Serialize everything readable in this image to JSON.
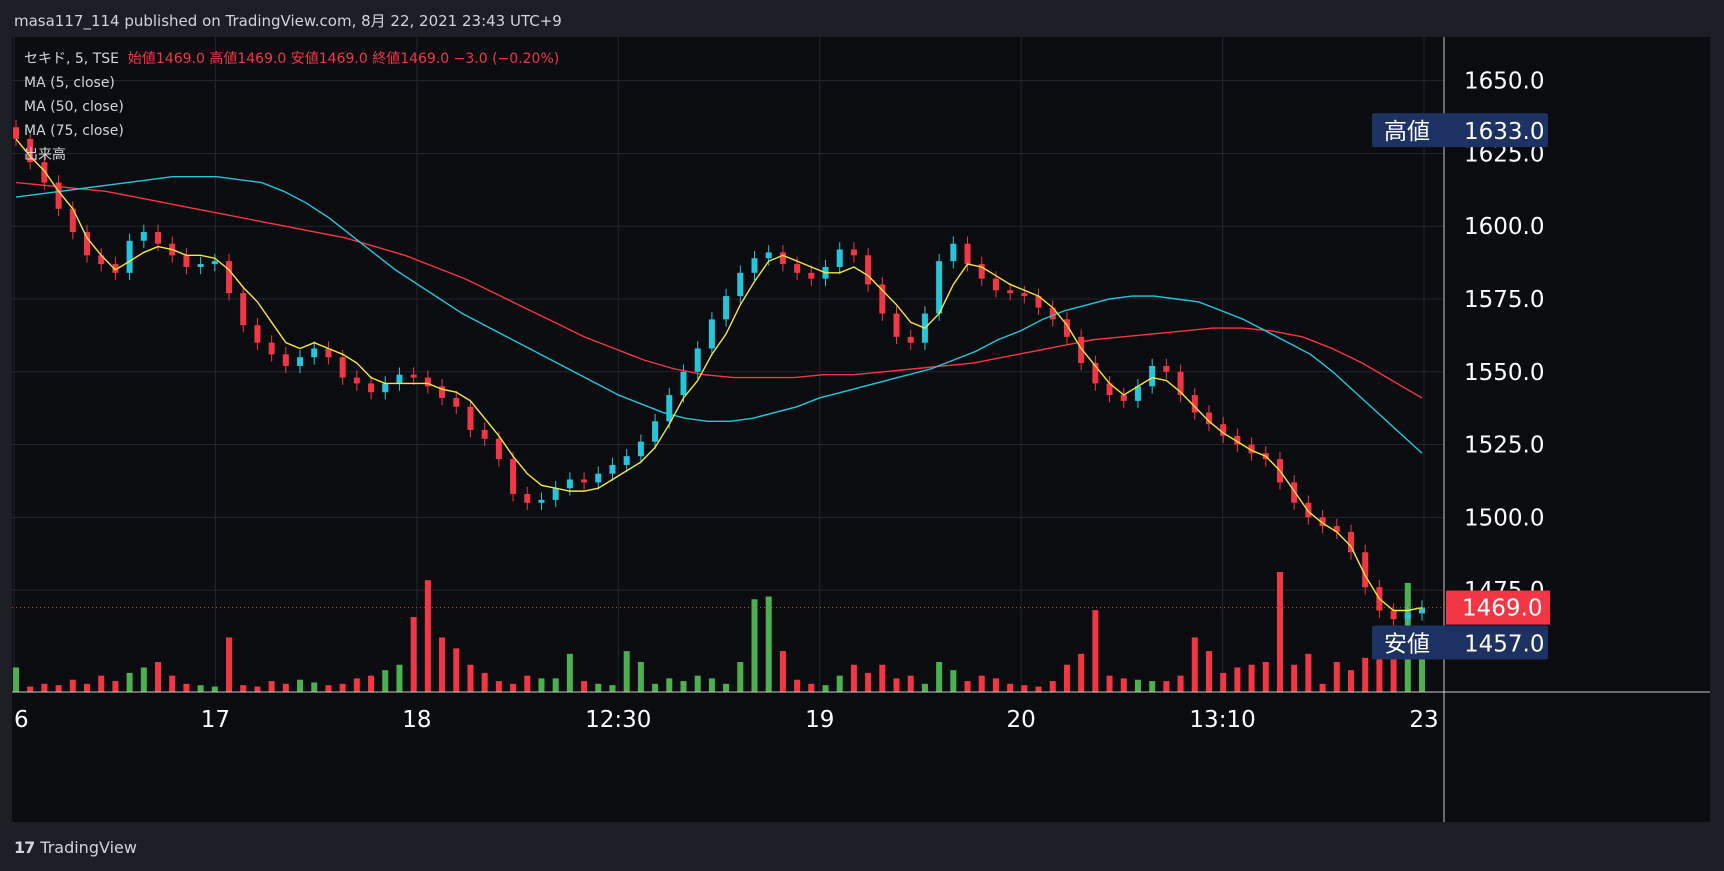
{
  "header": {
    "published_text": "masa117_114 published on TradingView.com, 8月 22, 2021 23:43 UTC+9"
  },
  "legend": {
    "symbol": "セキド, 5, TSE",
    "ohlc": "始値1469.0 高値1469.0 安値1469.0 終値1469.0 −3.0 (−0.20%)",
    "ma5": "MA (5, close)",
    "ma50": "MA (50, close)",
    "ma75": "MA (75, close)",
    "volume": "出来高"
  },
  "footer": {
    "brand": "TradingView",
    "logo_glyph": "17"
  },
  "colors": {
    "bg": "#0b0c10",
    "up": "#26c6da",
    "down": "#f23645",
    "ma5": "#f5e642",
    "ma50": "#26c6da",
    "ma75": "#f23645",
    "vol_up": "#4caf50",
    "vol_down": "#f23645",
    "label_bg": "#1e3163"
  },
  "chart_data": {
    "type": "candlestick",
    "x_ticks": [
      "6",
      "17",
      "18",
      "12:30",
      "19",
      "20",
      "13:10",
      "23"
    ],
    "y_ticks": [
      "1650.0",
      "1625.0",
      "1600.0",
      "1575.0",
      "1550.0",
      "1525.0",
      "1500.0",
      "1475.0"
    ],
    "ylim": [
      1440,
      1665
    ],
    "markers": [
      {
        "label": "高値",
        "value": "1633.0"
      },
      {
        "label": "安値",
        "value": "1457.0"
      }
    ],
    "last_price": "1469.0",
    "closes": [
      1630,
      1622,
      1615,
      1606,
      1598,
      1590,
      1587,
      1584,
      1595,
      1598,
      1594,
      1590,
      1586,
      1587,
      1588,
      1577,
      1566,
      1560,
      1556,
      1552,
      1555,
      1558,
      1555,
      1548,
      1546,
      1543,
      1546,
      1549,
      1548,
      1545,
      1541,
      1538,
      1530,
      1527,
      1520,
      1508,
      1505,
      1506,
      1510,
      1513,
      1512,
      1515,
      1518,
      1521,
      1526,
      1533,
      1542,
      1550,
      1558,
      1568,
      1576,
      1584,
      1589,
      1591,
      1587,
      1584,
      1582,
      1586,
      1592,
      1590,
      1580,
      1570,
      1562,
      1560,
      1570,
      1588,
      1594,
      1587,
      1582,
      1578,
      1577,
      1576,
      1572,
      1568,
      1562,
      1553,
      1546,
      1542,
      1540,
      1545,
      1552,
      1550,
      1542,
      1536,
      1532,
      1528,
      1525,
      1522,
      1520,
      1512,
      1505,
      1500,
      1497,
      1495,
      1488,
      1476,
      1468,
      1465,
      1467,
      1469
    ],
    "ma5": [
      1630,
      1624,
      1619,
      1612,
      1606,
      1596,
      1590,
      1585,
      1588,
      1591,
      1593,
      1592,
      1590,
      1590,
      1589,
      1585,
      1579,
      1574,
      1567,
      1560,
      1558,
      1560,
      1558,
      1556,
      1553,
      1548,
      1546,
      1546,
      1546,
      1546,
      1544,
      1543,
      1540,
      1534,
      1528,
      1521,
      1515,
      1511,
      1510,
      1509,
      1509,
      1510,
      1513,
      1516,
      1519,
      1524,
      1532,
      1541,
      1547,
      1556,
      1563,
      1573,
      1581,
      1588,
      1590,
      1588,
      1586,
      1584,
      1584,
      1586,
      1583,
      1578,
      1573,
      1567,
      1565,
      1570,
      1580,
      1587,
      1586,
      1583,
      1580,
      1578,
      1576,
      1572,
      1566,
      1558,
      1552,
      1546,
      1542,
      1545,
      1548,
      1547,
      1543,
      1538,
      1533,
      1529,
      1526,
      1523,
      1521,
      1516,
      1509,
      1502,
      1498,
      1495,
      1490,
      1480,
      1472,
      1468,
      1468,
      1469
    ],
    "ma50": [
      1610,
      1611,
      1612,
      1613,
      1614,
      1615,
      1616,
      1617,
      1617,
      1617,
      1616,
      1615,
      1612,
      1608,
      1603,
      1597,
      1591,
      1585,
      1580,
      1575,
      1570,
      1566,
      1562,
      1558,
      1554,
      1550,
      1546,
      1542,
      1539,
      1536,
      1534,
      1533,
      1533,
      1534,
      1536,
      1538,
      1541,
      1543,
      1545,
      1547,
      1549,
      1551,
      1554,
      1557,
      1561,
      1564,
      1568,
      1571,
      1573,
      1575,
      1576,
      1576,
      1575,
      1574,
      1571,
      1568,
      1564,
      1560,
      1556,
      1550,
      1543,
      1536,
      1529,
      1522
    ],
    "ma75": [
      1615,
      1614,
      1613,
      1612,
      1610,
      1608,
      1606,
      1604,
      1602,
      1600,
      1598,
      1596,
      1593,
      1590,
      1586,
      1582,
      1577,
      1572,
      1567,
      1562,
      1558,
      1554,
      1551,
      1549,
      1548,
      1548,
      1548,
      1549,
      1549,
      1550,
      1551,
      1552,
      1553,
      1555,
      1557,
      1559,
      1561,
      1562,
      1563,
      1564,
      1565,
      1565,
      1564,
      1562,
      1558,
      1553,
      1547,
      1541
    ],
    "volume": [
      18,
      4,
      6,
      5,
      9,
      6,
      12,
      8,
      14,
      18,
      22,
      12,
      6,
      5,
      4,
      40,
      5,
      4,
      8,
      6,
      9,
      7,
      5,
      6,
      10,
      12,
      16,
      20,
      55,
      82,
      40,
      32,
      20,
      14,
      8,
      6,
      12,
      10,
      10,
      28,
      8,
      6,
      5,
      30,
      22,
      6,
      10,
      8,
      12,
      10,
      6,
      22,
      68,
      70,
      30,
      9,
      6,
      5,
      12,
      20,
      14,
      20,
      10,
      12,
      6,
      22,
      16,
      8,
      12,
      10,
      6,
      5,
      4,
      8,
      20,
      28,
      60,
      12,
      10,
      9,
      8,
      8,
      12,
      40,
      30,
      14,
      18,
      20,
      22,
      88,
      20,
      28,
      6,
      22,
      16,
      25,
      26,
      30,
      80,
      40
    ]
  }
}
